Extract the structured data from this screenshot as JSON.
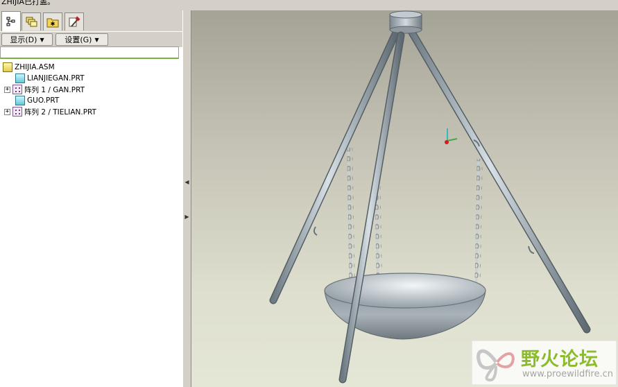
{
  "window": {
    "title_fragment": "ZHIJIA已打盖。"
  },
  "tabs": [
    {
      "name": "model-tree",
      "icon": "model-tree-icon",
      "active": true
    },
    {
      "name": "layers",
      "icon": "layers-icon",
      "active": false
    },
    {
      "name": "favorites",
      "icon": "folder-star-icon",
      "active": false
    },
    {
      "name": "tools",
      "icon": "hammer-icon",
      "active": false
    }
  ],
  "toolbar": {
    "show_label": "显示(D)",
    "settings_label": "设置(G)"
  },
  "filter": {
    "value": ""
  },
  "tree": {
    "root": "ZHIJIA.ASM",
    "items": [
      {
        "label": "LIANJIEGAN.PRT",
        "type": "part",
        "expandable": false
      },
      {
        "label": "阵列 1 / GAN.PRT",
        "type": "pattern",
        "expandable": true
      },
      {
        "label": "GUO.PRT",
        "type": "part",
        "expandable": false
      },
      {
        "label": "阵列 2 / TIELIAN.PRT",
        "type": "pattern",
        "expandable": true
      }
    ]
  },
  "watermark": {
    "title": "野火论坛",
    "url": "www.proewildfire.cn"
  },
  "colors": {
    "accent_green": "#77b340",
    "viewport_top": "#a5a396",
    "viewport_bottom": "#e4e6d6"
  }
}
